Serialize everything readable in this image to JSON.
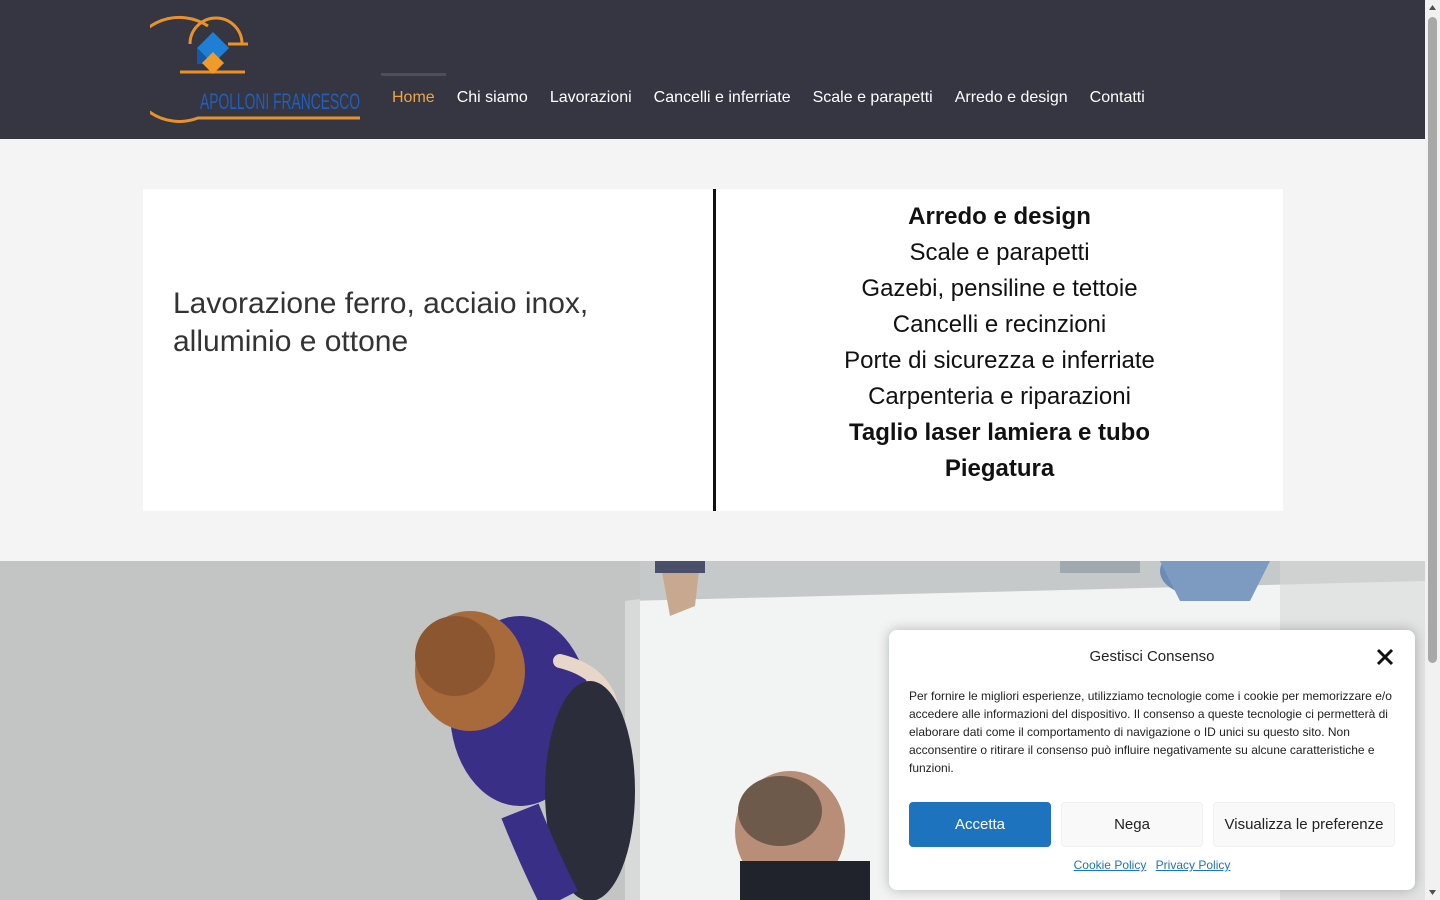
{
  "brand": {
    "name": "APOLLONI FRANCESCO"
  },
  "nav": {
    "items": [
      "Home",
      "Chi siamo",
      "Lavorazioni",
      "Cancelli e inferriate",
      "Scale e parapetti",
      "Arredo e design",
      "Contatti"
    ],
    "active": "Home"
  },
  "hero": {
    "title": "Lavorazione ferro, acciaio inox, alluminio e ottone",
    "services": [
      {
        "label": "Arredo e design",
        "bold": true
      },
      {
        "label": "Scale e parapetti",
        "bold": false
      },
      {
        "label": "Gazebi, pensiline e tettoie",
        "bold": false
      },
      {
        "label": "Cancelli e recinzioni",
        "bold": false
      },
      {
        "label": "Porte di sicurezza e inferriate",
        "bold": false
      },
      {
        "label": "Carpenteria e riparazioni",
        "bold": false
      },
      {
        "label": "Taglio laser lamiera e tubo",
        "bold": true
      },
      {
        "label": "Piegatura",
        "bold": true
      }
    ]
  },
  "cookie": {
    "title": "Gestisci Consenso",
    "text": "Per fornire le migliori esperienze, utilizziamo tecnologie come i cookie per memorizzare e/o accedere alle informazioni del dispositivo. Il consenso a queste tecnologie ci permetterà di elaborare dati come il comportamento di navigazione o ID unici su questo sito. Non acconsentire o ritirare il consenso può influire negativamente su alcune caratteristiche e funzioni.",
    "accept": "Accetta",
    "deny": "Nega",
    "preferences": "Visualizza le preferenze",
    "cookie_policy": "Cookie Policy",
    "privacy_policy": "Privacy Policy"
  },
  "colors": {
    "header_bg": "#353641",
    "nav_active": "#f0a640",
    "accent_blue": "#1e73be",
    "logo_orange": "#e8932a",
    "logo_blue": "#1f5fbf"
  }
}
